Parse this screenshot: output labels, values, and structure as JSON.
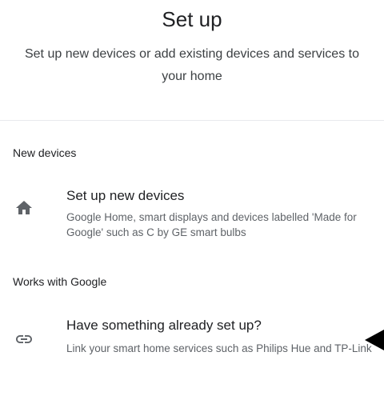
{
  "header": {
    "title": "Set up",
    "subtitle": "Set up new devices or add existing devices and services to your home"
  },
  "sections": [
    {
      "header": "New devices",
      "item": {
        "icon": "home-icon",
        "title": "Set up new devices",
        "description": "Google Home, smart displays and devices labelled 'Made for Google' such as C by GE smart bulbs"
      }
    },
    {
      "header": "Works with Google",
      "item": {
        "icon": "link-icon",
        "title": "Have something already set up?",
        "description": "Link your smart home services such as Philips Hue and TP-Link"
      }
    }
  ],
  "overlay": {
    "icon": "pointer-arrow-icon",
    "color": "#000000"
  }
}
